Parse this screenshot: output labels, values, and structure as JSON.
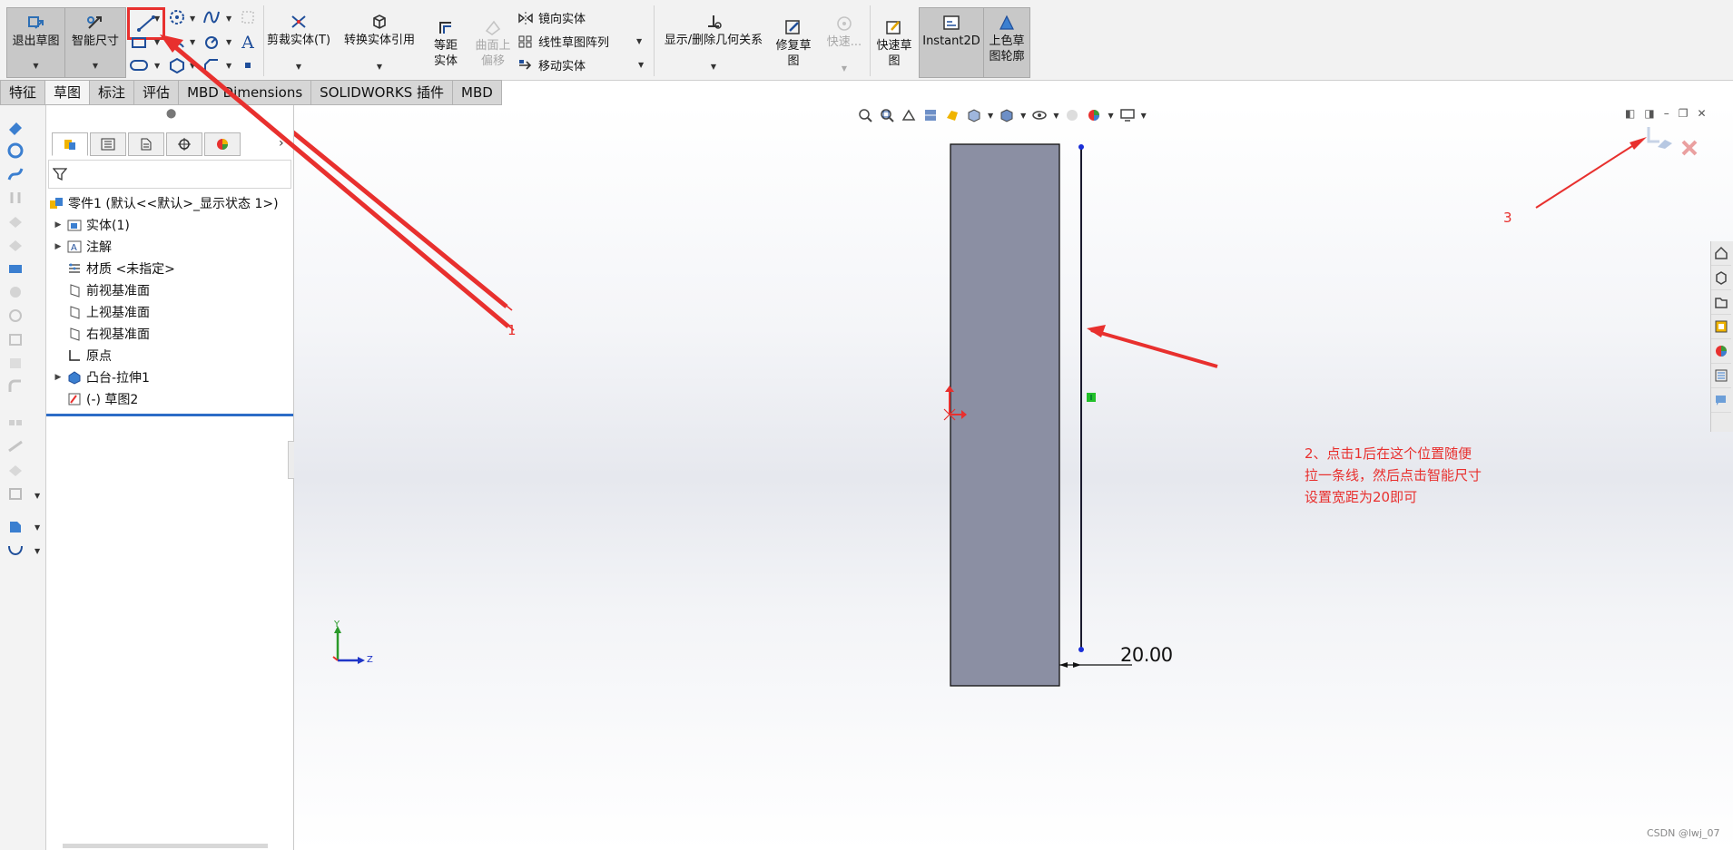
{
  "ribbon": {
    "exit_sketch": "退出草图",
    "smart_dimension": "智能尺寸",
    "trim_entities": "剪裁实体(T)",
    "convert_entities": "转换实体引用",
    "offset_entities": "等距实体",
    "offset_on_surface": "曲面上偏移",
    "mirror_entities": "镜向实体",
    "linear_pattern": "线性草图阵列",
    "move_entities": "移动实体",
    "display_relations": "显示/删除几何关系",
    "repair_sketch": "修复草图",
    "quick_snaps": "快速...",
    "rapid_sketch": "快速草图",
    "instant2d": "Instant2D",
    "shaded_contours": "上色草图轮廓"
  },
  "tabs": [
    "特征",
    "草图",
    "标注",
    "评估",
    "MBD Dimensions",
    "SOLIDWORKS 插件",
    "MBD"
  ],
  "tree": {
    "part": "零件1 (默认<<默认>_显示状态 1>)",
    "solid_bodies": "实体(1)",
    "annotations": "注解",
    "material": "材质 <未指定>",
    "front_plane": "前视基准面",
    "top_plane": "上视基准面",
    "right_plane": "右视基准面",
    "origin": "原点",
    "boss_extrude": "凸台-拉伸1",
    "sketch2": "(-) 草图2"
  },
  "annotations": {
    "label1": "1",
    "label2_line1": "2、点击1后在这个位置随便",
    "label2_line2": "拉一条线，然后点击智能尺寸",
    "label2_line3": "设置宽距为20即可",
    "label3": "3"
  },
  "viewport": {
    "dimension_value": "20.00",
    "axis_y": "Y",
    "axis_z": "Z",
    "watermark": "CSDN @lwj_07"
  },
  "colors": {
    "annotation_red": "#e8302e",
    "body_fill": "#8b8fa3",
    "sketch_line": "#1a1a2e",
    "endpoint_blue": "#1a2fd8",
    "relation_green": "#22c02a"
  }
}
